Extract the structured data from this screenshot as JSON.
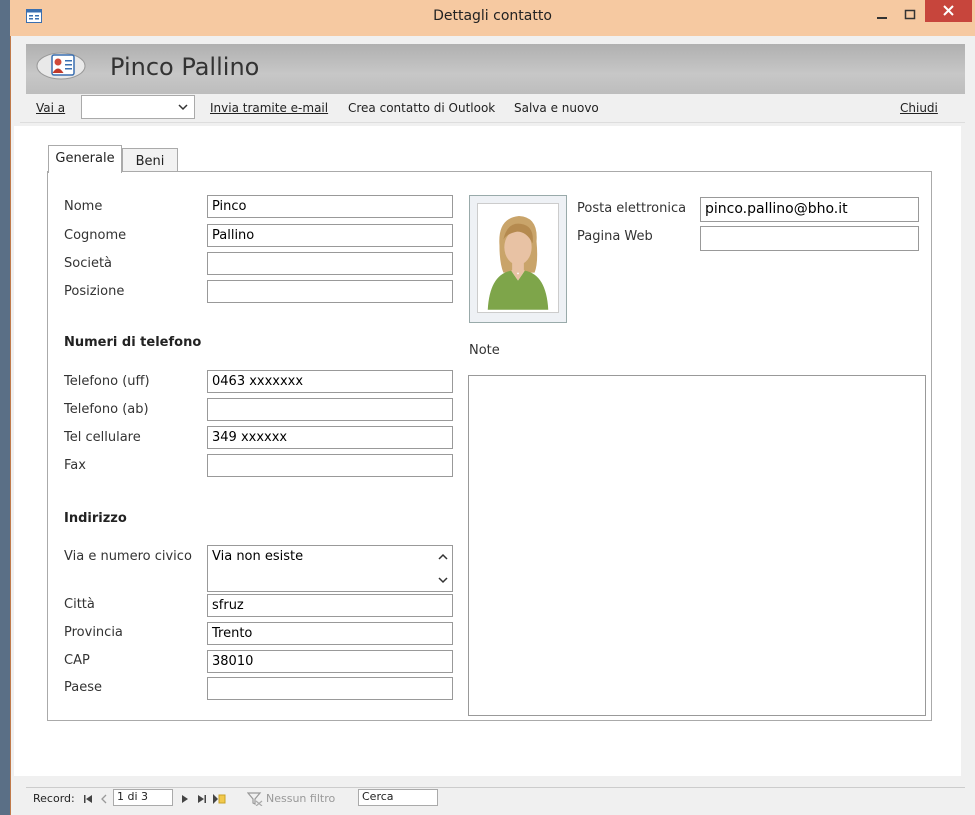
{
  "window": {
    "title": "Dettagli contatto"
  },
  "header": {
    "contact_name": "Pinco Pallino"
  },
  "commands": {
    "goto_label": "Vai a",
    "goto_value": "",
    "send_email": "Invia tramite e-mail",
    "create_outlook": "Crea contatto di Outlook",
    "save_new": "Salva e nuovo",
    "close": "Chiudi"
  },
  "tabs": [
    {
      "label": "Generale",
      "selected": true
    },
    {
      "label": "Beni",
      "selected": false
    }
  ],
  "general": {
    "labels": {
      "nome": "Nome",
      "cognome": "Cognome",
      "societa": "Società",
      "posizione": "Posizione"
    },
    "values": {
      "nome": "Pinco",
      "cognome": "Pallino",
      "societa": "",
      "posizione": ""
    }
  },
  "phones": {
    "section": "Numeri di telefono",
    "labels": {
      "uff": "Telefono (uff)",
      "ab": "Telefono (ab)",
      "cell": "Tel cellulare",
      "fax": "Fax"
    },
    "values": {
      "uff": "0463 xxxxxxx",
      "ab": "",
      "cell": "349 xxxxxx",
      "fax": ""
    }
  },
  "address": {
    "section": "Indirizzo",
    "labels": {
      "via": "Via e numero civico",
      "citta": "Città",
      "provincia": "Provincia",
      "cap": "CAP",
      "paese": "Paese"
    },
    "values": {
      "via": "Via non esiste",
      "citta": "sfruz",
      "provincia": "Trento",
      "cap": "38010",
      "paese": ""
    }
  },
  "web": {
    "labels": {
      "email": "Posta elettronica",
      "web": "Pagina Web"
    },
    "values": {
      "email": "pinco.pallino@bho.it",
      "web": ""
    }
  },
  "notes": {
    "label": "Note",
    "value": ""
  },
  "statusbar": {
    "record_label": "Record:",
    "record_value": "1 di 3",
    "filter": "Nessun filtro",
    "search_placeholder": "Cerca"
  },
  "colors": {
    "titlebar": "#f6c9a1",
    "close_button": "#c7453c",
    "header_band": "#bdbdbd"
  }
}
